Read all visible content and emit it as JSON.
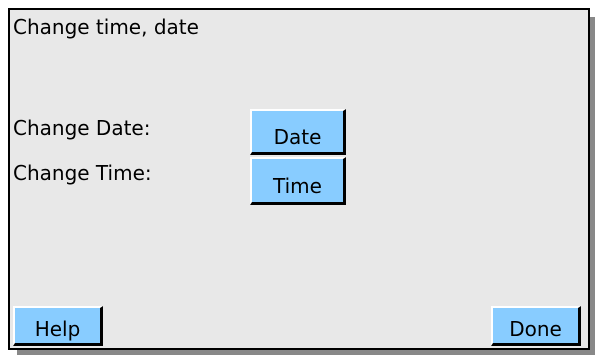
{
  "window": {
    "title": "Change time, date"
  },
  "rows": [
    {
      "label": "Change Date:",
      "button_label": "Date"
    },
    {
      "label": "Change Time:",
      "button_label": "Time"
    }
  ],
  "footer": {
    "help_label": "Help",
    "done_label": "Done"
  },
  "colors": {
    "panel_background": "#e8e8e8",
    "button_background": "#88ccff",
    "shadow": "#888888"
  }
}
